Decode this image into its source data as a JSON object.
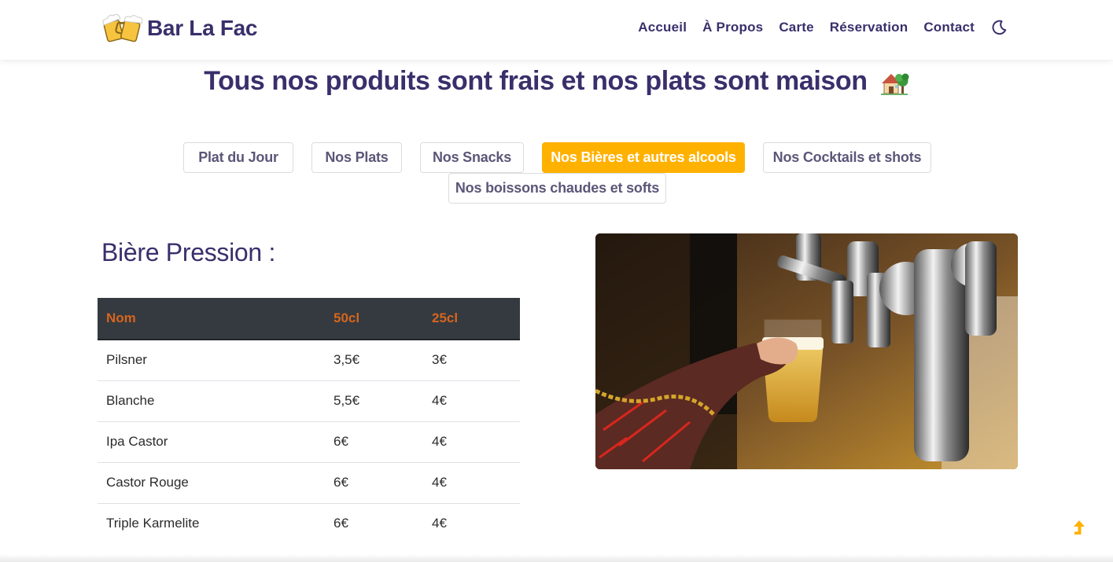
{
  "brand": {
    "name": "Bar La Fac",
    "logo_icon": "beer-mugs-icon"
  },
  "nav": {
    "links": [
      "Accueil",
      "À Propos",
      "Carte",
      "Réservation",
      "Contact"
    ],
    "theme_icon": "moon-icon"
  },
  "headline": {
    "text": "Tous nos produits sont frais et nos plats sont maison",
    "emoji_icon": "house-with-tree-icon"
  },
  "tabs": [
    {
      "label": "Plat du Jour",
      "active": false
    },
    {
      "label": "Nos Plats",
      "active": false
    },
    {
      "label": "Nos Snacks",
      "active": false
    },
    {
      "label": "Nos Bières et autres alcools",
      "active": true
    },
    {
      "label": "Nos Cocktails et shots",
      "active": false
    },
    {
      "label": "Nos boissons chaudes et softs",
      "active": false
    }
  ],
  "section": {
    "title": "Bière Pression :",
    "table": {
      "headers": [
        "Nom",
        "50cl",
        "25cl"
      ],
      "rows": [
        [
          "Pilsner",
          "3,5€",
          "3€"
        ],
        [
          "Blanche",
          "5,5€",
          "4€"
        ],
        [
          "Ipa Castor",
          "6€",
          "4€"
        ],
        [
          "Castor Rouge",
          "6€",
          "4€"
        ],
        [
          "Triple Karmelite",
          "6€",
          "4€"
        ]
      ]
    }
  },
  "photo": {
    "subject": "beer-tap-pouring-photo"
  },
  "scroll_top_icon": "arrow-up-icon",
  "colors": {
    "accent": "#ffb100",
    "brand": "#3a2f6b",
    "table_header_bg": "#343a40",
    "table_header_text": "#d7651d"
  }
}
